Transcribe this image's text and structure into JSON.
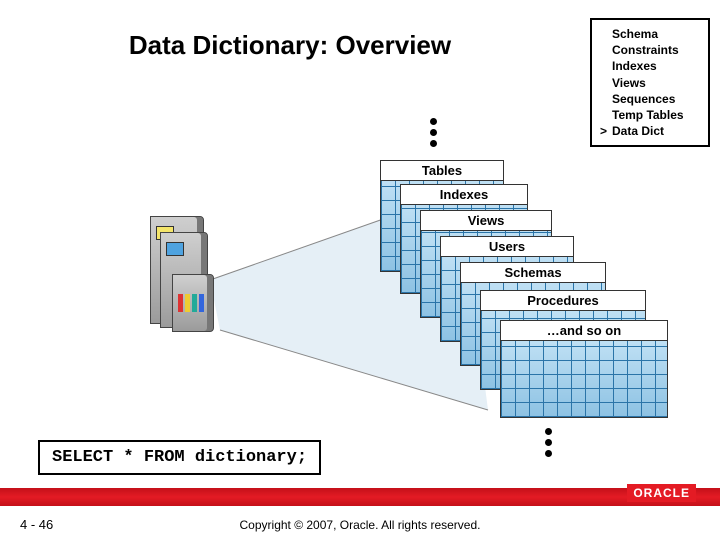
{
  "title": "Data Dictionary: Overview",
  "menu": {
    "items": [
      {
        "label": "Schema",
        "marker": ""
      },
      {
        "label": "Constraints",
        "marker": ""
      },
      {
        "label": "Indexes",
        "marker": ""
      },
      {
        "label": "Views",
        "marker": ""
      },
      {
        "label": "Sequences",
        "marker": ""
      },
      {
        "label": "Temp Tables",
        "marker": ""
      },
      {
        "label": "Data Dict",
        "marker": ">"
      }
    ]
  },
  "stack_labels": {
    "l1": "Tables",
    "l2": "Indexes",
    "l3": "Views",
    "l4": "Users",
    "l5": "Schemas",
    "l6": "Procedures",
    "l7": "…and so on"
  },
  "sql": "SELECT * FROM dictionary;",
  "footer": {
    "page": "4 - 46",
    "copyright": "Copyright © 2007, Oracle. All rights reserved.",
    "logo_text": "ORACLE"
  }
}
